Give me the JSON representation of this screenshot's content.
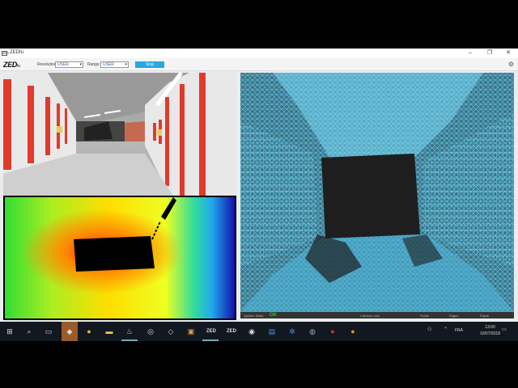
{
  "window": {
    "title": "ZEDfu",
    "icon_label": "ZED",
    "controls": [
      "–",
      "❐",
      "✕"
    ]
  },
  "toolbar": {
    "brand": "ZED",
    "brand_suffix": "fu",
    "resolution_label": "Resolution",
    "resolution_value": "USER",
    "range_label": "Range",
    "range_value": "USER",
    "stop_label": "Stop",
    "settings_icon": "gear-icon"
  },
  "views": {
    "camera": "left-camera-image",
    "depth": "depth-map",
    "cloud": "point-cloud-mesh"
  },
  "cloud_status": {
    "tracking_label": "System State:",
    "tracking_value": "OK",
    "items": [
      "Camera Lock",
      "Points",
      "Edges",
      "Faces"
    ]
  },
  "taskbar": {
    "icons": [
      "windows-start-icon",
      "search-icon",
      "task-view-icon",
      "unity-icon",
      "chrome-icon",
      "file-explorer-icon",
      "steam-icon",
      "obs-icon",
      "unity-hub-icon",
      "app-icon",
      "zed-app-icon",
      "zed-depth-icon",
      "vr-icon",
      "app-icon-2",
      "settings-app-icon",
      "app-icon-3",
      "firefox-icon"
    ],
    "tray_language": "FRA",
    "time": "13:00",
    "date": "10/07/2018"
  },
  "colors": {
    "accent": "#2ba6de",
    "status_ok": "#22cc22",
    "taskbar": "#111820",
    "mesh": "#5bc8ea"
  }
}
